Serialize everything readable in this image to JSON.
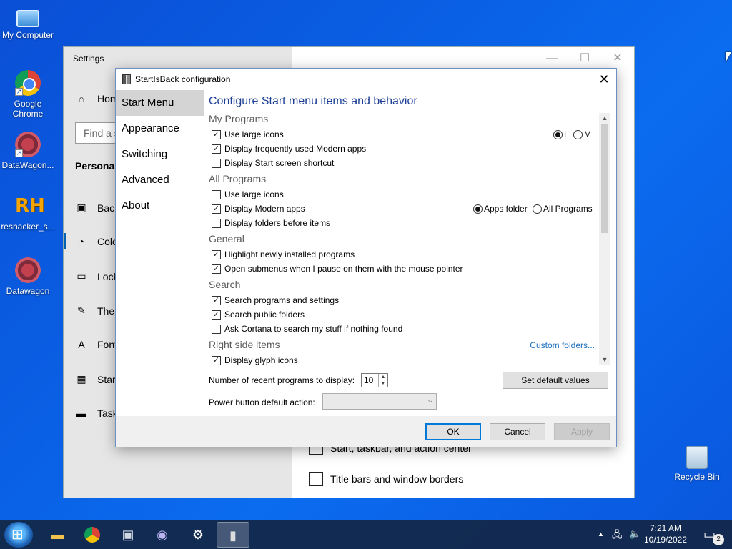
{
  "desktop": {
    "icons": [
      {
        "label": "My Computer"
      },
      {
        "label": "Google Chrome"
      },
      {
        "label": "DataWagon..."
      },
      {
        "label": "reshacker_s..."
      },
      {
        "label": "Datawagon"
      },
      {
        "label": "Recycle Bin"
      }
    ],
    "rh_glyph": "RH"
  },
  "settings_window": {
    "title": "Settings",
    "controls": {
      "minimize": "—",
      "maximize": "☐",
      "close": "✕"
    },
    "home": "Home",
    "search_placeholder": "Find a s",
    "section": "Personali",
    "items": [
      {
        "label": "Back",
        "icon": "image-icon"
      },
      {
        "label": "Colo",
        "icon": "palette-icon"
      },
      {
        "label": "Lock",
        "icon": "lock-screen-icon"
      },
      {
        "label": "Ther",
        "icon": "themes-icon"
      },
      {
        "label": "Font",
        "icon": "font-icon"
      },
      {
        "label": "Start",
        "icon": "start-icon"
      },
      {
        "label": "Task",
        "icon": "taskbar-icon"
      }
    ],
    "checks": [
      {
        "label": "Start, taskbar, and action center",
        "checked": false
      },
      {
        "label": "Title bars and window borders",
        "checked": false
      }
    ]
  },
  "dialog": {
    "title": "StartIsBack configuration",
    "close": "✕",
    "nav": [
      "Start Menu",
      "Appearance",
      "Switching",
      "Advanced",
      "About"
    ],
    "heading": "Configure Start menu items and behavior",
    "sections": {
      "my_programs": "My Programs",
      "all_programs": "All Programs",
      "general": "General",
      "search": "Search",
      "right_side": "Right side items"
    },
    "options": {
      "mp_large_icons": {
        "label": "Use large icons",
        "checked": true
      },
      "mp_modern_apps": {
        "label": "Display frequently used Modern apps",
        "checked": true
      },
      "mp_start_shortcut": {
        "label": "Display Start screen shortcut",
        "checked": false
      },
      "ap_large_icons": {
        "label": "Use large icons",
        "checked": false
      },
      "ap_modern_apps": {
        "label": "Display Modern apps",
        "checked": true
      },
      "ap_folders_first": {
        "label": "Display folders before items",
        "checked": false
      },
      "gen_highlight": {
        "label": "Highlight newly installed programs",
        "checked": true
      },
      "gen_submenus": {
        "label": "Open submenus when I pause on them with the mouse pointer",
        "checked": true
      },
      "srch_programs": {
        "label": "Search programs and settings",
        "checked": true
      },
      "srch_public": {
        "label": "Search public folders",
        "checked": true
      },
      "srch_cortana": {
        "label": "Ask Cortana to search my stuff if nothing found",
        "checked": false
      },
      "rs_glyph": {
        "label": "Display glyph icons",
        "checked": true
      }
    },
    "icon_size_radio": {
      "l": "L",
      "m": "M",
      "selected": "L"
    },
    "modern_apps_radio": {
      "apps_folder": "Apps folder",
      "all_programs": "All Programs",
      "selected": "Apps folder"
    },
    "custom_folders": "Custom folders...",
    "recent_label": "Number of recent programs to display:",
    "recent_value": "10",
    "set_default": "Set default values",
    "power_label": "Power button default action:",
    "power_value": "",
    "ok": "OK",
    "cancel": "Cancel",
    "apply": "Apply"
  },
  "taskbar": {
    "time": "7:21 AM",
    "date": "10/19/2022",
    "notification_count": "2",
    "pinned": [
      "file-explorer-icon",
      "chrome-icon",
      "monitor-app-icon",
      "torrent-icon",
      "settings-gear-icon",
      "startisback-icon"
    ]
  }
}
